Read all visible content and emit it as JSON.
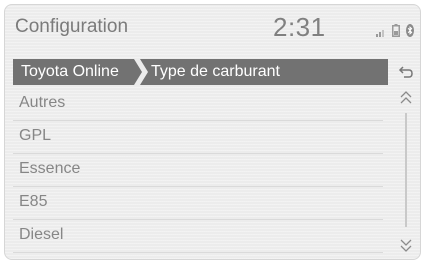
{
  "header": {
    "title": "Configuration",
    "clock": "2:31",
    "status_icons": [
      "signal-icon",
      "battery-icon",
      "bluetooth-icon"
    ]
  },
  "breadcrumb": [
    "Toyota Online",
    "Type de carburant"
  ],
  "fuel_options": [
    "Autres",
    "GPL",
    "Essence",
    "E85",
    "Diesel"
  ],
  "controls": {
    "back": "return-arrow-icon",
    "scroll_up": "chevron-double-up-icon",
    "scroll_down": "chevron-double-down-icon"
  },
  "colors": {
    "breadcrumb_bg": "#727272",
    "text": "#868686",
    "background": "#ececec"
  }
}
